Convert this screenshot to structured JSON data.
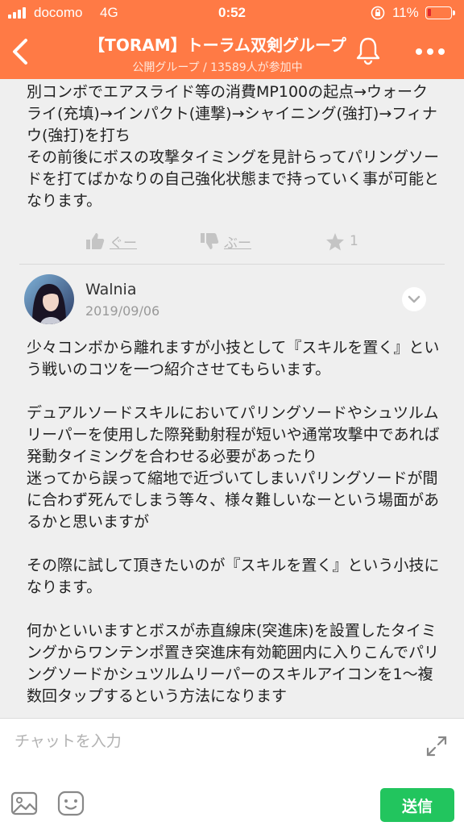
{
  "status_bar": {
    "carrier": "docomo",
    "network": "4G",
    "time": "0:52",
    "battery_percent": "11%"
  },
  "header": {
    "title": "【TORAM】トーラム双剣グループ",
    "subtitle": "公開グループ / 13589人が参加中"
  },
  "messages": [
    {
      "text": "別コンボでエアスライド等の消費MP100の起点→ウォークライ(充填)→インパクト(連撃)→シャイニング(強打)→フィナウ(強打)を打ち\nその前後にボスの攻撃タイミングを見計らってパリングソードを打てばかなりの自己強化状態まで持っていく事が可能となります。",
      "reactions": {
        "like_label": "ぐー",
        "dislike_label": "ぶー",
        "star_count": "1"
      }
    },
    {
      "username": "Walnia",
      "date": "2019/09/06",
      "text": "少々コンボから離れますが小技として『スキルを置く』という戦いのコツを一つ紹介させてもらいます。\n\nデュアルソードスキルにおいてパリングソードやシュツルムリーパーを使用した際発動射程が短いや通常攻撃中であれば発動タイミングを合わせる必要があったり\n迷ってから誤って縮地で近づいてしまいパリングソードが間に合わず死んでしまう等々、様々難しいなーという場面があるかと思いますが\n\nその際に試して頂きたいのが『スキルを置く』という小技になります。\n\n何かといいますとボスが赤直線床(突進床)を設置したタイミングからワンテンポ置き突進床有効範囲内に入りこんでパリングソードかシュツルムリーパーのスキルアイコンを1〜複数回タップするという方法になります"
    }
  ],
  "composer": {
    "placeholder": "チャットを入力",
    "send_label": "送信"
  },
  "colors": {
    "header": "#ff7a45",
    "send": "#22c55e"
  }
}
